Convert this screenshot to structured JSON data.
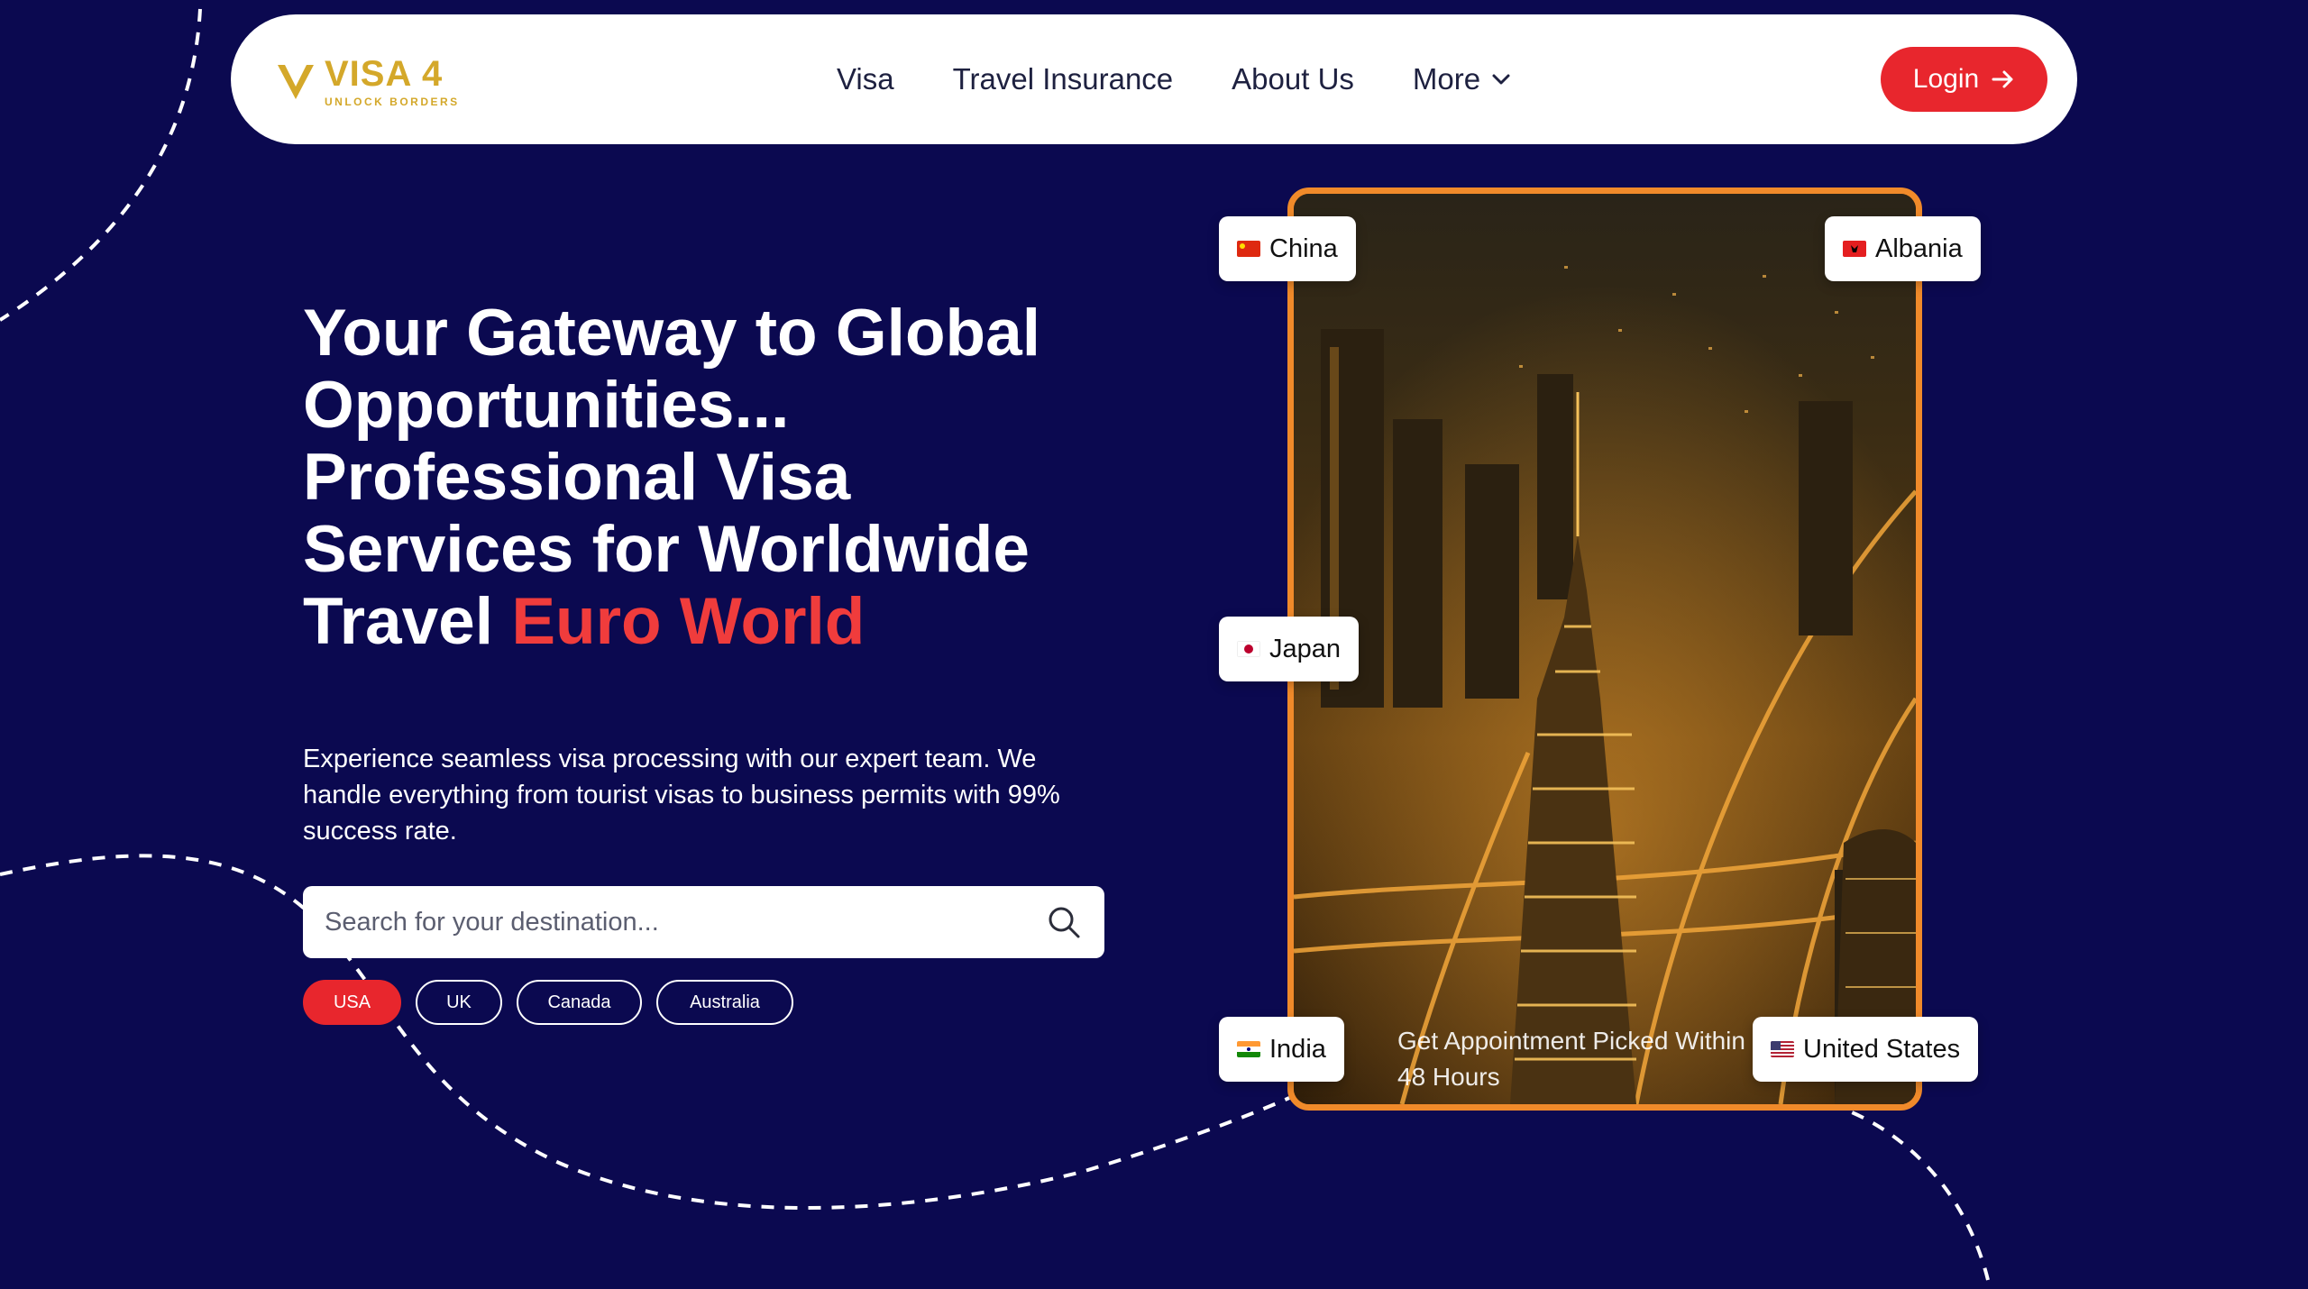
{
  "brand": {
    "name": "VISA 4",
    "tagline": "UNLOCK BORDERS",
    "logo_color": "#d4a82a"
  },
  "nav": {
    "items": [
      {
        "label": "Visa"
      },
      {
        "label": "Travel Insurance"
      },
      {
        "label": "About Us"
      },
      {
        "label": "More"
      }
    ],
    "login_label": "Login"
  },
  "hero": {
    "title_main": "Your Gateway to Global Opportunities... Professional Visa Services for Worldwide Travel ",
    "title_accent": "Euro World",
    "description": "Experience seamless visa processing with our expert team. We handle everything from tourist visas to business permits with 99% success rate.",
    "search_placeholder": "Search for your destination...",
    "chips": [
      {
        "label": "USA",
        "active": true
      },
      {
        "label": "UK",
        "active": false
      },
      {
        "label": "Canada",
        "active": false
      },
      {
        "label": "Australia",
        "active": false
      }
    ]
  },
  "showcase": {
    "caption": "Get Appointment Picked Within 48 Hours",
    "countries": [
      {
        "name": "China",
        "flag_icon": "china-flag-icon"
      },
      {
        "name": "Albania",
        "flag_icon": "albania-flag-icon"
      },
      {
        "name": "Japan",
        "flag_icon": "japan-flag-icon"
      },
      {
        "name": "India",
        "flag_icon": "india-flag-icon"
      },
      {
        "name": "United States",
        "flag_icon": "us-flag-icon"
      }
    ]
  },
  "colors": {
    "background": "#0b0950",
    "accent_red": "#e8262d",
    "card_border": "#f08a2a"
  }
}
